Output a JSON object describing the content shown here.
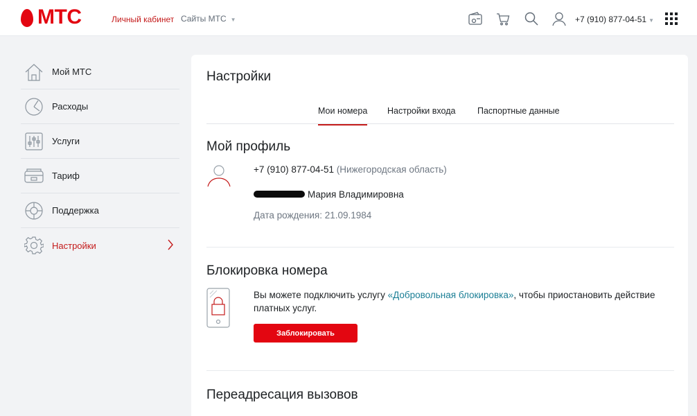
{
  "header": {
    "logo_text": "МТС",
    "nav_personal": "Личный кабинет",
    "nav_sites": "Сайты МТС",
    "phone": "+7 (910) 877-04-51",
    "icons": [
      "wallet-icon",
      "cart-icon",
      "search-icon",
      "user-icon",
      "apps-grid-icon"
    ]
  },
  "sidebar": {
    "items": [
      {
        "label": "Мой МТС",
        "icon": "home-icon"
      },
      {
        "label": "Расходы",
        "icon": "expenses-icon"
      },
      {
        "label": "Услуги",
        "icon": "services-icon"
      },
      {
        "label": "Тариф",
        "icon": "tariff-icon"
      },
      {
        "label": "Поддержка",
        "icon": "support-icon"
      },
      {
        "label": "Настройки",
        "icon": "settings-icon",
        "active": true
      }
    ]
  },
  "main": {
    "title": "Настройки",
    "tabs": [
      {
        "label": "Мои номера",
        "active": true
      },
      {
        "label": "Настройки входа"
      },
      {
        "label": "Паспортные данные"
      }
    ],
    "profile": {
      "title": "Мой профиль",
      "phone": "+7 (910) 877-04-51",
      "region": "(Нижегородская область)",
      "name": "Мария Владимировна",
      "birth_date": "Дата рождения: 21.09.1984"
    },
    "blocking": {
      "title": "Блокировка номера",
      "text_before": "Вы можете подключить услугу ",
      "link": "«Добровольная блокировка»",
      "text_after": ", чтобы приостановить действие платных услуг.",
      "button": "Заблокировать"
    },
    "forwarding": {
      "title": "Переадресация вызовов"
    }
  },
  "colors": {
    "brand_red": "#e30611",
    "active_red": "#c41a1a",
    "link_teal": "#1a7e95",
    "background": "#f2f3f5"
  }
}
